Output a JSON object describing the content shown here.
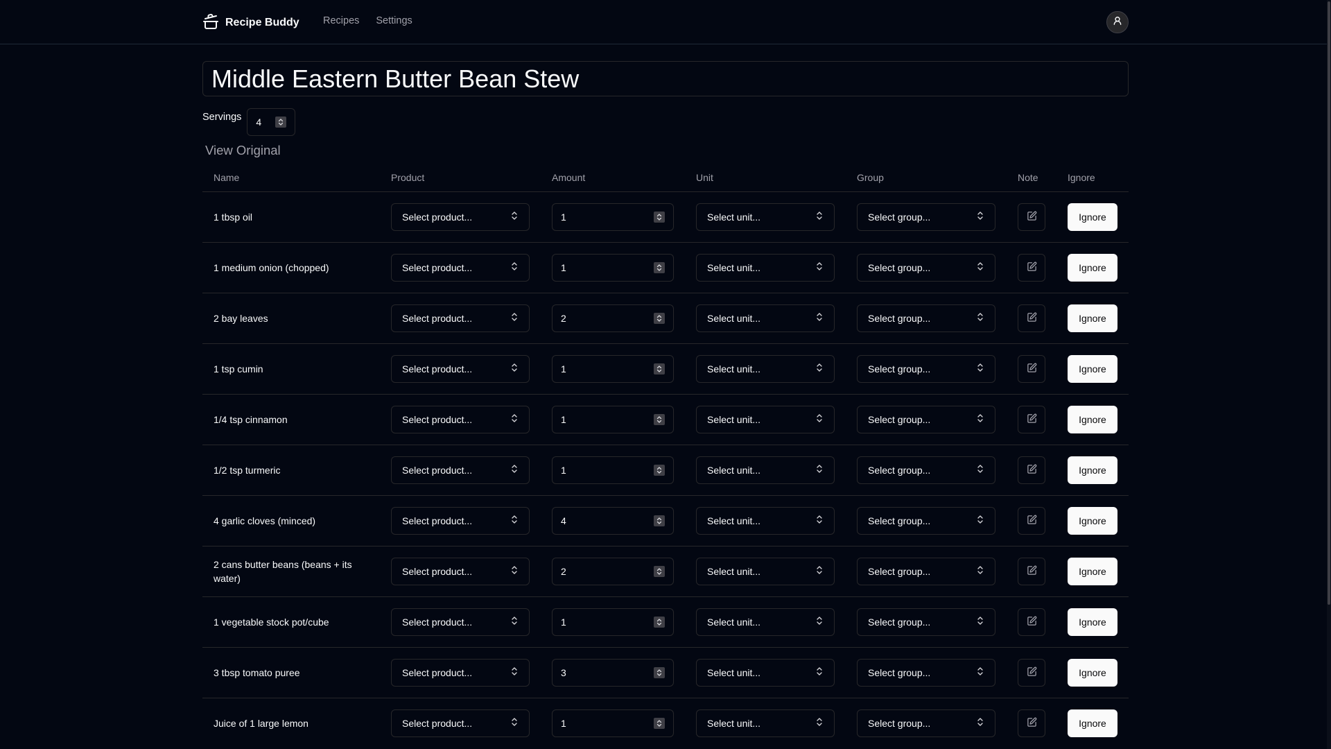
{
  "app": {
    "name": "Recipe Buddy"
  },
  "nav": {
    "links": [
      "Recipes",
      "Settings"
    ]
  },
  "recipe": {
    "title": "Middle Eastern Butter Bean Stew"
  },
  "servings": {
    "label": "Servings",
    "value": "4"
  },
  "view_original": "View Original",
  "table": {
    "headers": [
      "Name",
      "Product",
      "Amount",
      "Unit",
      "Group",
      "Note",
      "Ignore"
    ],
    "product_placeholder": "Select product...",
    "unit_placeholder": "Select unit...",
    "group_placeholder": "Select group...",
    "ignore_label": "Ignore",
    "rows": [
      {
        "name": "1 tbsp oil",
        "amount": "1"
      },
      {
        "name": "1 medium onion (chopped)",
        "amount": "1"
      },
      {
        "name": "2 bay leaves",
        "amount": "2"
      },
      {
        "name": "1 tsp cumin",
        "amount": "1"
      },
      {
        "name": "1/4 tsp cinnamon",
        "amount": "1"
      },
      {
        "name": "1/2 tsp turmeric",
        "amount": "1"
      },
      {
        "name": "4 garlic cloves (minced)",
        "amount": "4"
      },
      {
        "name": "2 cans butter beans (beans + its water)",
        "amount": "2"
      },
      {
        "name": "1 vegetable stock pot/cube",
        "amount": "1"
      },
      {
        "name": "3 tbsp tomato puree",
        "amount": "3"
      },
      {
        "name": "Juice of 1 large lemon",
        "amount": "1"
      }
    ]
  },
  "icons": {
    "logo": "cooking-pot-icon",
    "avatar": "user-icon",
    "select": "chevrons-up-down-icon",
    "note": "edit-note-icon",
    "stepper": "number-stepper-icon"
  }
}
